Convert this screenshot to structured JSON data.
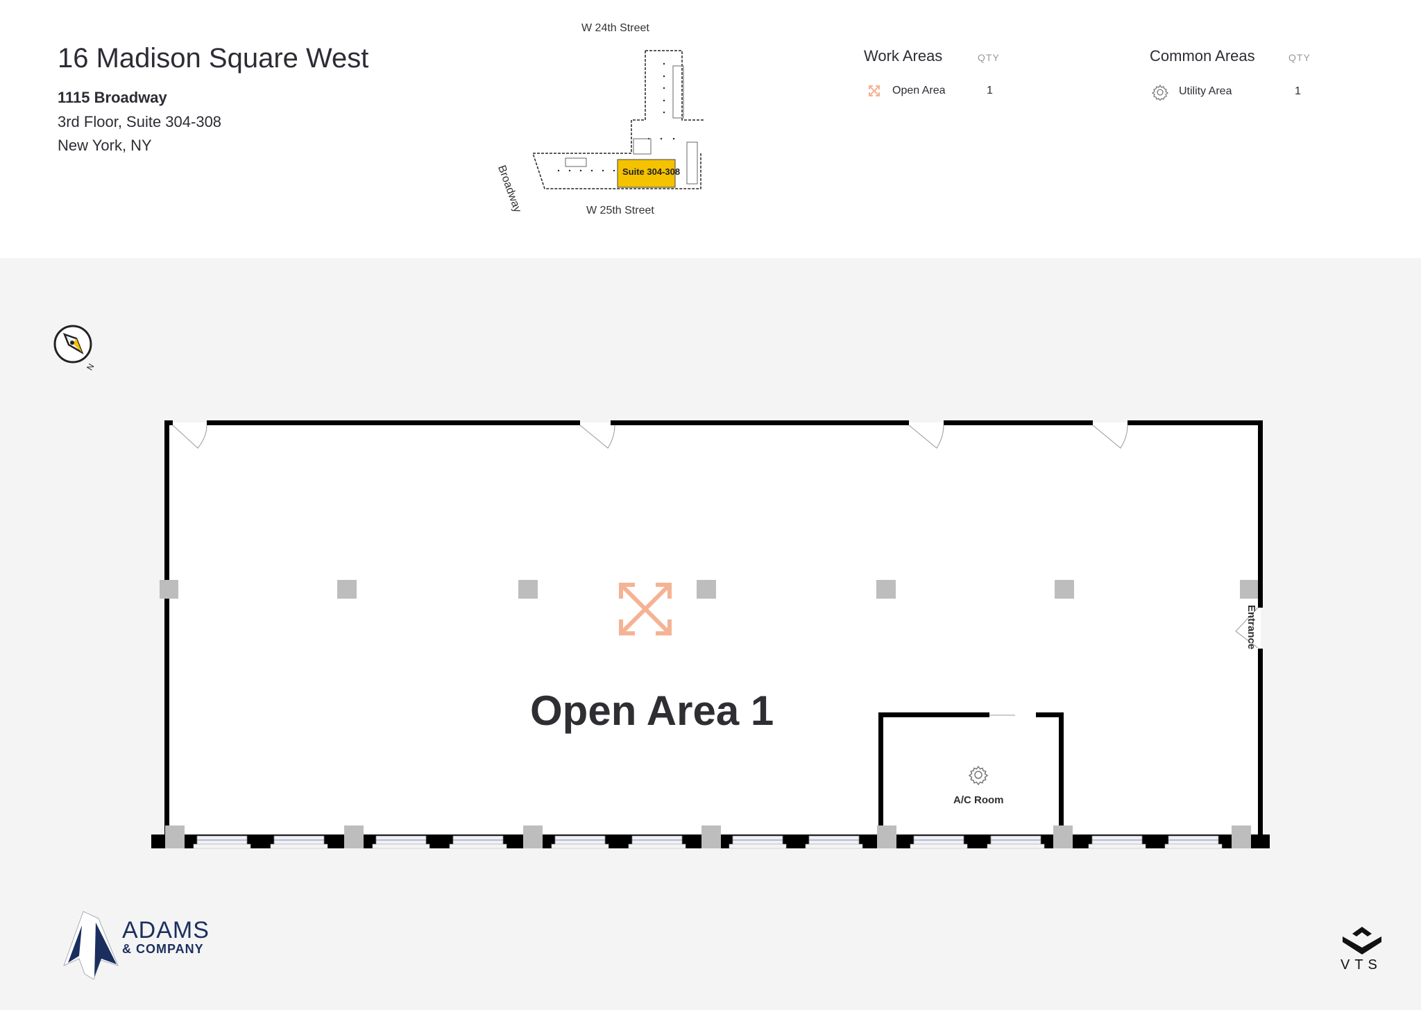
{
  "header": {
    "building_name": "16 Madison Square West",
    "address_line1": "1115 Broadway",
    "address_line2": "3rd Floor, Suite 304-308",
    "address_line3": "New York, NY"
  },
  "keyplan": {
    "street_top": "W 24th Street",
    "street_bottom": "W 25th Street",
    "street_side": "Broadway",
    "suite_label": "Suite 304-308",
    "suite_color": "#f5c200"
  },
  "legend": {
    "work_areas": {
      "heading": "Work Areas",
      "qty_label": "QTY",
      "items": [
        {
          "icon": "expand-arrows-icon",
          "label": "Open Area",
          "qty": "1"
        }
      ]
    },
    "common_areas": {
      "heading": "Common Areas",
      "qty_label": "QTY",
      "items": [
        {
          "icon": "gear-icon",
          "label": "Utility Area",
          "qty": "1"
        }
      ]
    }
  },
  "floorplan": {
    "compass_label": "N",
    "main_area_label": "Open Area 1",
    "main_area_icon": "expand-arrows-icon",
    "main_area_icon_color": "#f4b394",
    "room_label": "A/C Room",
    "room_icon": "gear-icon",
    "entrance_label": "Entrance"
  },
  "footer": {
    "brand_left_line1": "ADAMS",
    "brand_left_line2": "& COMPANY",
    "brand_left_color": "#1b2f5e",
    "brand_right": "VTS"
  }
}
